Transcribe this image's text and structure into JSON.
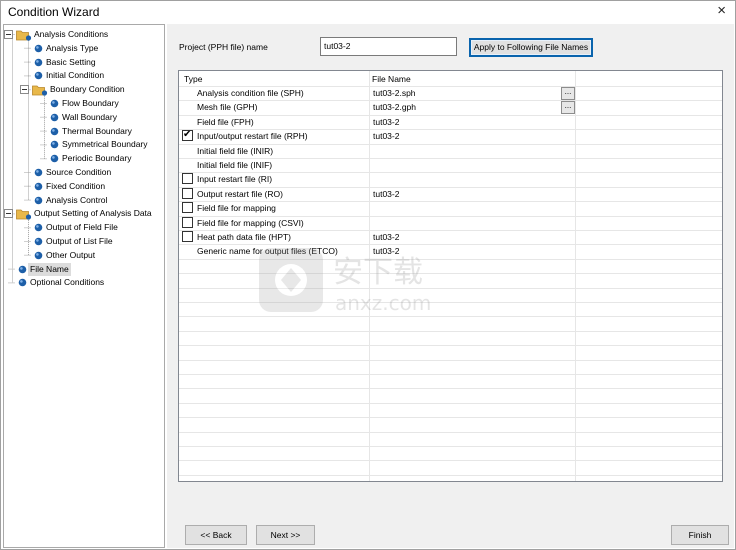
{
  "window": {
    "title": "Condition Wizard",
    "close_symbol": "×"
  },
  "tree": {
    "items": [
      {
        "label": "Analysis Conditions",
        "level": 0,
        "icon": "folder-icon",
        "expander": "minus",
        "selected": false
      },
      {
        "label": "Analysis Type",
        "level": 1,
        "icon": "node-icon",
        "selected": false
      },
      {
        "label": "Basic Setting",
        "level": 1,
        "icon": "node-icon",
        "selected": false
      },
      {
        "label": "Initial Condition",
        "level": 1,
        "icon": "node-icon",
        "selected": false
      },
      {
        "label": "Boundary Condition",
        "level": 1,
        "icon": "folder-icon",
        "expander": "minus",
        "selected": false
      },
      {
        "label": "Flow Boundary",
        "level": 2,
        "icon": "node-icon",
        "selected": false
      },
      {
        "label": "Wall Boundary",
        "level": 2,
        "icon": "node-icon",
        "selected": false
      },
      {
        "label": "Thermal Boundary",
        "level": 2,
        "icon": "node-icon",
        "selected": false
      },
      {
        "label": "Symmetrical Boundary",
        "level": 2,
        "icon": "node-icon",
        "selected": false
      },
      {
        "label": "Periodic Boundary",
        "level": 2,
        "icon": "node-icon",
        "selected": false
      },
      {
        "label": "Source Condition",
        "level": 1,
        "icon": "node-icon",
        "selected": false
      },
      {
        "label": "Fixed Condition",
        "level": 1,
        "icon": "node-icon",
        "selected": false
      },
      {
        "label": "Analysis Control",
        "level": 1,
        "icon": "node-icon",
        "selected": false
      },
      {
        "label": "Output Setting of Analysis Data",
        "level": 0,
        "icon": "folder-icon",
        "expander": "minus",
        "selected": false
      },
      {
        "label": "Output of Field File",
        "level": 1,
        "icon": "node-icon",
        "selected": false
      },
      {
        "label": "Output of List File",
        "level": 1,
        "icon": "node-icon",
        "selected": false
      },
      {
        "label": "Other Output",
        "level": 1,
        "icon": "node-icon",
        "selected": false
      },
      {
        "label": "File Name",
        "level": 0,
        "icon": "node-icon",
        "selected": true
      },
      {
        "label": "Optional Conditions",
        "level": 0,
        "icon": "node-icon",
        "selected": false
      }
    ]
  },
  "project": {
    "label": "Project (PPH file) name",
    "value": "tut03-2",
    "apply_label": "Apply to Following File Names"
  },
  "grid": {
    "columns": [
      "Type",
      "File Name"
    ],
    "rows": [
      {
        "type": "Analysis condition file (SPH)",
        "file": "tut03-2.sph",
        "checkbox": null,
        "browse": true
      },
      {
        "type": "Mesh file (GPH)",
        "file": "tut03-2.gph",
        "checkbox": null,
        "browse": true
      },
      {
        "type": "Field file (FPH)",
        "file": "tut03-2",
        "checkbox": null,
        "browse": false
      },
      {
        "type": "Input/output restart file (RPH)",
        "file": "tut03-2",
        "checkbox": true,
        "browse": false
      },
      {
        "type": "Initial field file (INIR)",
        "file": "",
        "checkbox": null,
        "browse": false
      },
      {
        "type": "Initial field file (INIF)",
        "file": "",
        "checkbox": null,
        "browse": false
      },
      {
        "type": "Input restart file (RI)",
        "file": "",
        "checkbox": false,
        "browse": false
      },
      {
        "type": "Output restart file (RO)",
        "file": "tut03-2",
        "checkbox": false,
        "browse": false
      },
      {
        "type": "Field file for mapping",
        "file": "",
        "checkbox": false,
        "browse": false
      },
      {
        "type": "Field file for mapping (CSVI)",
        "file": "",
        "checkbox": false,
        "browse": false
      },
      {
        "type": "Heat path data file (HPT)",
        "file": "tut03-2",
        "checkbox": false,
        "browse": false
      },
      {
        "type": "Generic name for output files (ETCO)",
        "file": "tut03-2",
        "checkbox": null,
        "browse": false
      }
    ],
    "browse_label": "...",
    "check_mark": "✔"
  },
  "buttons": {
    "back": "<< Back",
    "next": "Next >>",
    "finish": "Finish"
  },
  "watermark": {
    "text_cn": "安下载",
    "text_en": "anxz.com"
  },
  "colors": {
    "folder": "#e8b84a",
    "node": "#1d5fa8",
    "accent": "#0a64ad"
  }
}
